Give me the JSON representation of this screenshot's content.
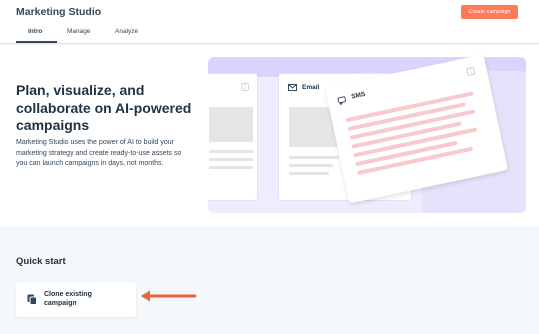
{
  "header": {
    "title": "Marketing Studio",
    "create_button": "Create campaign"
  },
  "tabs": [
    {
      "label": "Intro",
      "active": true
    },
    {
      "label": "Manage",
      "active": false
    },
    {
      "label": "Analyze",
      "active": false
    }
  ],
  "hero": {
    "title": "Plan, visualize, and collaborate on AI-powered campaigns",
    "description": "Marketing Studio uses the power of AI to build your marketing strategy and create ready-to-use assets so you can launch campaigns in days, not months."
  },
  "illustration": {
    "email_label": "Email",
    "sms_label": "SMS",
    "more_glyph": "⋮"
  },
  "quick_start": {
    "title": "Quick start",
    "clone_label": "Clone existing campaign"
  },
  "colors": {
    "accent": "#ff7a59",
    "arrow": "#e8643f",
    "text_dark": "#213343",
    "illustration_bg": "#f1ebff"
  }
}
